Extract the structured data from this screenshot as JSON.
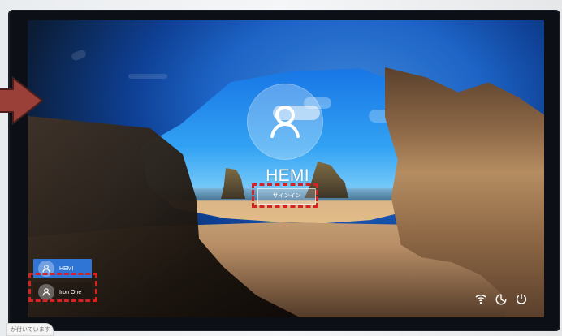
{
  "lock_screen": {
    "user_name": "HEMI",
    "signin_label": "サインイン"
  },
  "user_list": {
    "items": [
      {
        "label": "HEMI",
        "state": "active"
      },
      {
        "label": "Iron One",
        "state": "inactive"
      }
    ]
  },
  "status_icons": [
    "network-icon",
    "accessibility-icon",
    "power-icon"
  ],
  "annotations": {
    "highlight_color": "#d52323",
    "arrow_color": "#9b3f39"
  },
  "sticker": {
    "text": "が付いています"
  }
}
